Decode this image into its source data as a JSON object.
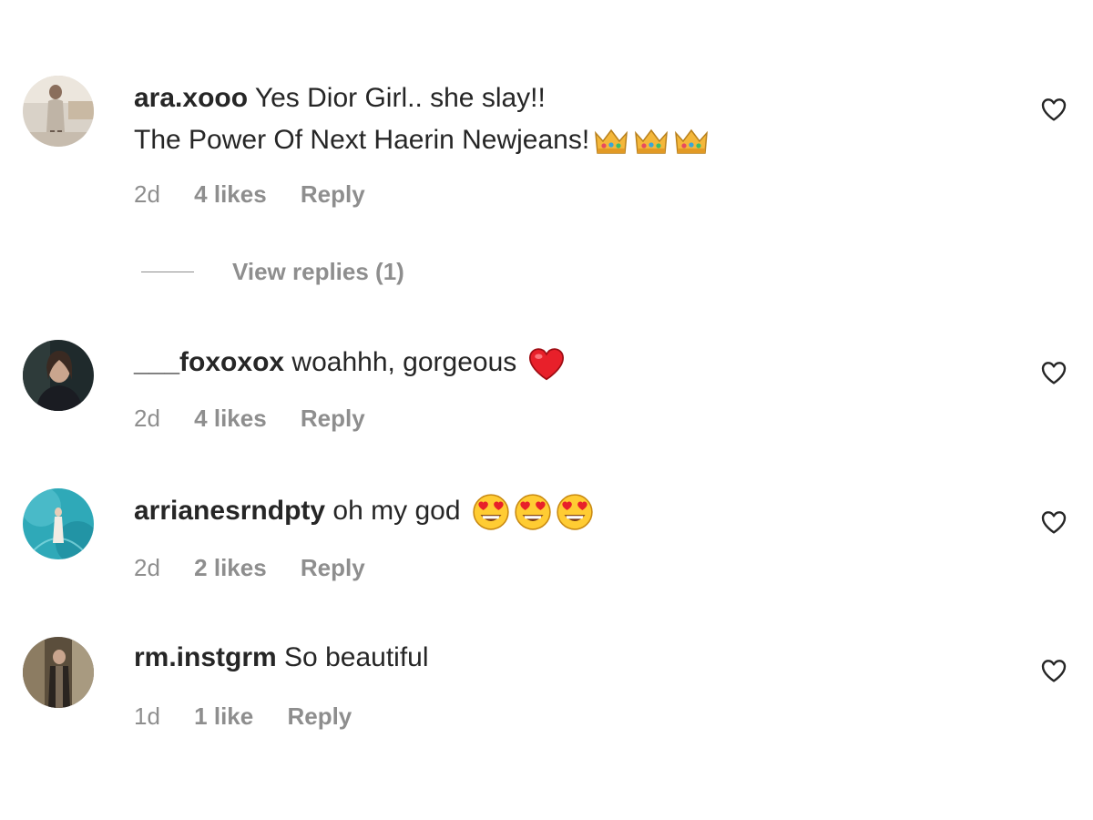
{
  "comments": [
    {
      "username": "ara.xooo",
      "text": "Yes Dior Girl.. she slay!!",
      "text_line2": "The Power Of Next Haerin Newjeans!",
      "emojis": [
        "crown",
        "crown",
        "crown"
      ],
      "time": "2d",
      "likes": "4 likes",
      "reply": "Reply"
    },
    {
      "username": "___foxoxox",
      "text": "woahhh, gorgeous",
      "emojis": [
        "red-heart"
      ],
      "time": "2d",
      "likes": "4 likes",
      "reply": "Reply"
    },
    {
      "username": "arrianesrndpty",
      "text": "oh my god",
      "emojis": [
        "heart-eyes",
        "heart-eyes",
        "heart-eyes"
      ],
      "time": "2d",
      "likes": "2 likes",
      "reply": "Reply"
    },
    {
      "username": "rm.instgrm",
      "text": "So beautiful",
      "emojis": [],
      "time": "1d",
      "likes": "1 like",
      "reply": "Reply"
    }
  ],
  "view_replies": "View replies (1)",
  "colors": {
    "text": "#262626",
    "muted": "#8e8e8e",
    "background": "#ffffff"
  }
}
